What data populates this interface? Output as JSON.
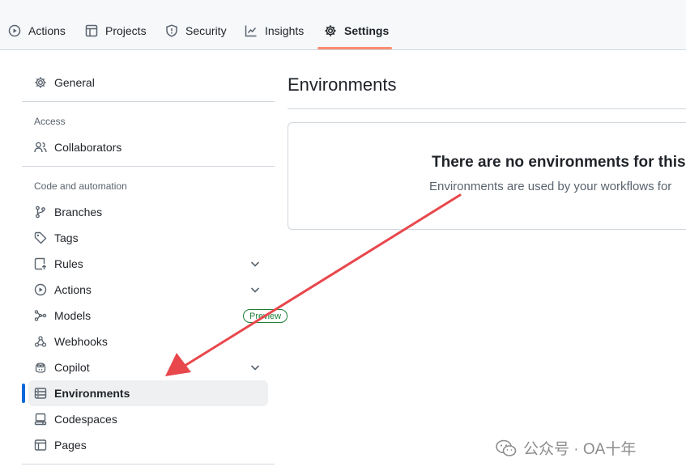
{
  "topnav": {
    "tabs": [
      {
        "label": "Actions",
        "icon": "play-circle-icon"
      },
      {
        "label": "Projects",
        "icon": "table-icon"
      },
      {
        "label": "Security",
        "icon": "shield-icon"
      },
      {
        "label": "Insights",
        "icon": "graph-icon"
      },
      {
        "label": "Settings",
        "icon": "gear-icon",
        "selected": true
      }
    ]
  },
  "sidebar": {
    "general": "General",
    "access_title": "Access",
    "collaborators": "Collaborators",
    "code_title": "Code and automation",
    "items": {
      "branches": "Branches",
      "tags": "Tags",
      "rules": "Rules",
      "actions": "Actions",
      "models": "Models",
      "models_badge": "Preview",
      "webhooks": "Webhooks",
      "copilot": "Copilot",
      "environments": "Environments",
      "codespaces": "Codespaces",
      "pages": "Pages"
    },
    "active_item": "Environments"
  },
  "main": {
    "title": "Environments",
    "blank_title": "There are no environments for this",
    "blank_text": "Environments are used by your workflows for"
  },
  "colors": {
    "accent_blue": "#0969da",
    "tab_underline": "#fd8c73",
    "badge_green": "#1a7f37",
    "annotation_arrow": "#e8474c"
  },
  "watermark": "公众号 · OA十年"
}
